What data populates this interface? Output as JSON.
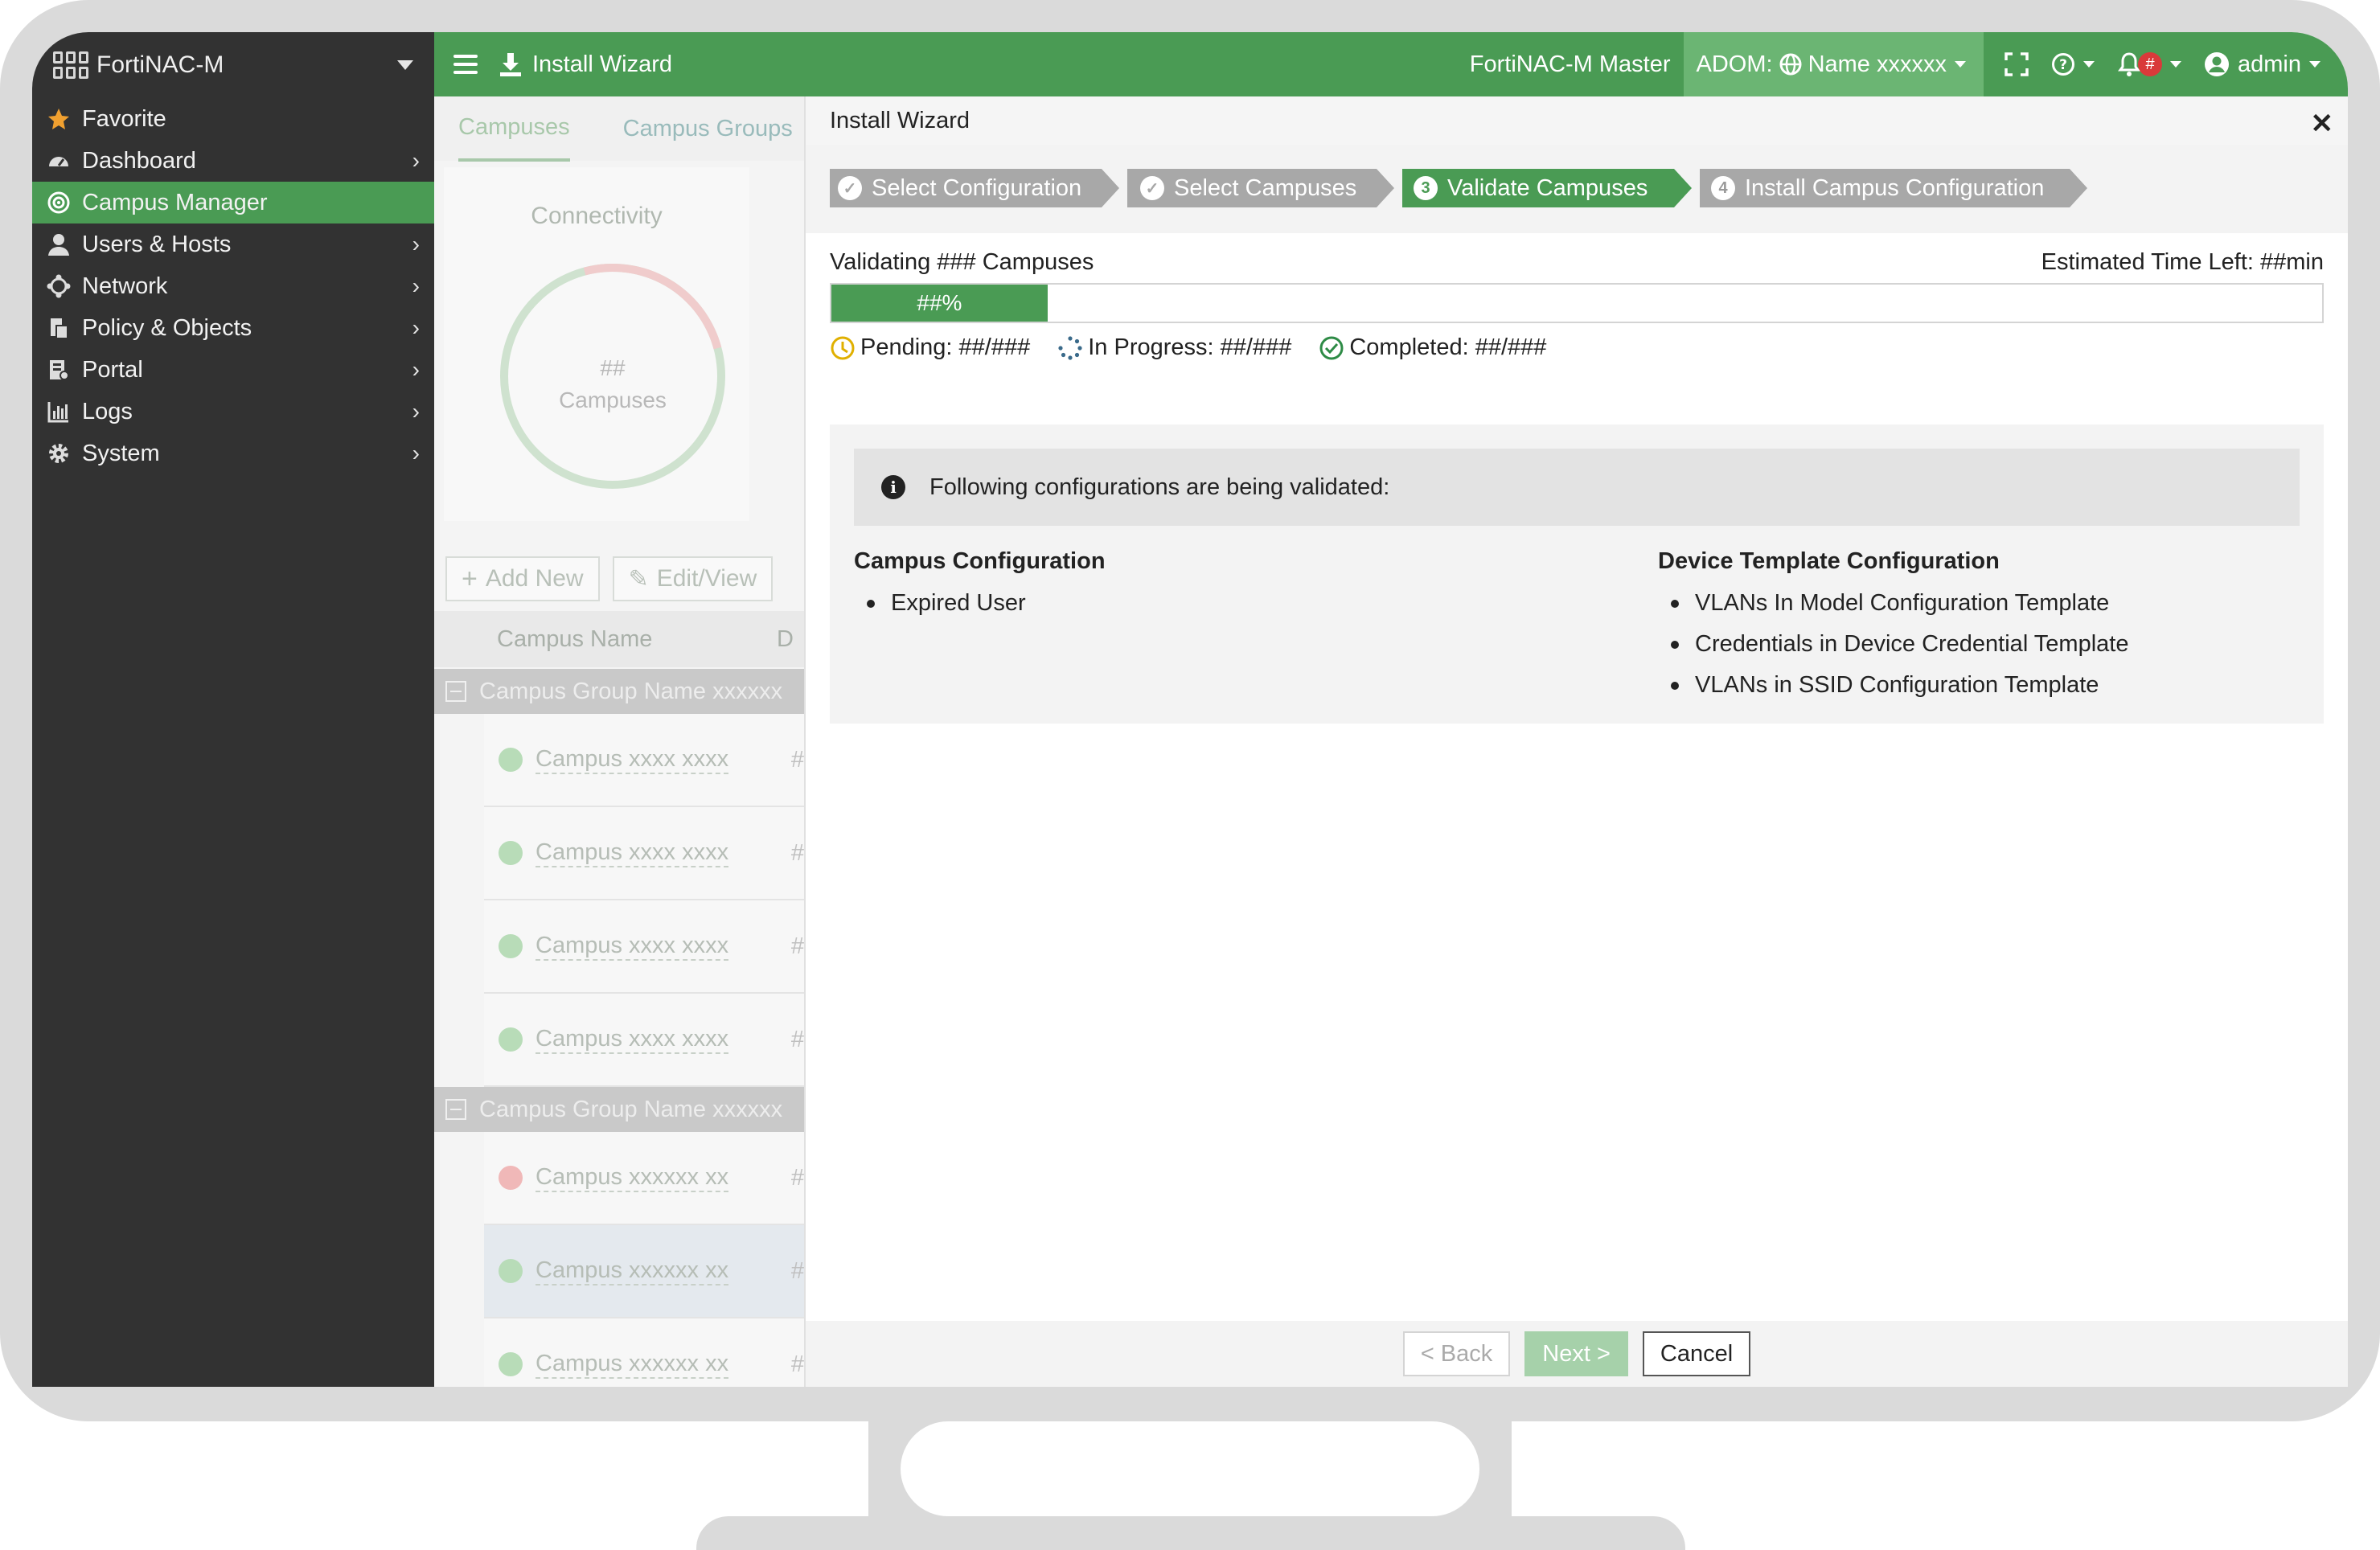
{
  "sidebar": {
    "product": "FortiNAC-M",
    "items": [
      {
        "label": "Favorite",
        "icon": "star-icon",
        "has_children": false,
        "active": false
      },
      {
        "label": "Dashboard",
        "icon": "dashboard-icon",
        "has_children": true,
        "active": false
      },
      {
        "label": "Campus Manager",
        "icon": "campus-icon",
        "has_children": false,
        "active": true
      },
      {
        "label": "Users & Hosts",
        "icon": "user-icon",
        "has_children": true,
        "active": false
      },
      {
        "label": "Network",
        "icon": "network-icon",
        "has_children": true,
        "active": false
      },
      {
        "label": "Policy & Objects",
        "icon": "policy-icon",
        "has_children": true,
        "active": false
      },
      {
        "label": "Portal",
        "icon": "portal-icon",
        "has_children": true,
        "active": false
      },
      {
        "label": "Logs",
        "icon": "logs-icon",
        "has_children": true,
        "active": false
      },
      {
        "label": "System",
        "icon": "gear-icon",
        "has_children": true,
        "active": false
      }
    ]
  },
  "topbar": {
    "page_title": "Install Wizard",
    "master": "FortiNAC-M Master",
    "adom_label": "ADOM:",
    "adom_name": "Name xxxxxx",
    "notification_count": "#",
    "user": "admin"
  },
  "background": {
    "tabs": [
      "Campuses",
      "Campus Groups"
    ],
    "card_title": "Connectivity",
    "donut_value": "##",
    "donut_label": "Campuses",
    "add_button": "Add New",
    "edit_button": "Edit/View",
    "column": "Campus Name",
    "column2": "D",
    "groups": [
      {
        "name": "Campus Group Name xxxxxx",
        "rows": [
          "Campus xxxx xxxx",
          "Campus xxxx xxxx",
          "Campus xxxx xxxx",
          "Campus xxxx xxxx"
        ]
      },
      {
        "name": "Campus Group Name xxxxxx",
        "rows": [
          "Campus xxxxxx xx",
          "Campus xxxxxx xx",
          "Campus xxxxxx xx"
        ]
      }
    ],
    "row_hash": "#"
  },
  "wizard": {
    "title": "Install Wizard",
    "steps": [
      {
        "label": "Select Configuration",
        "state": "done"
      },
      {
        "label": "Select Campuses",
        "state": "done"
      },
      {
        "label": "Validate Campuses",
        "state": "current",
        "number": "3"
      },
      {
        "label": "Install Campus Configuration",
        "state": "todo",
        "number": "4"
      }
    ],
    "validating_text": "Validating ### Campuses",
    "estimated_time": "Estimated Time Left: ##min",
    "progress_label": "##%",
    "progress_fraction": 0.145,
    "pending": "Pending: ##/###",
    "in_progress": "In Progress: ##/###",
    "completed": "Completed: ##/###",
    "notice": "Following configurations are being validated:",
    "campus_config": {
      "title": "Campus Configuration",
      "items": [
        "Expired User"
      ]
    },
    "device_config": {
      "title": "Device Template Configuration",
      "items": [
        "VLANs In Model Configuration Template",
        "Credentials in Device Credential Template",
        "VLANs in SSID Configuration Template"
      ]
    },
    "buttons": {
      "back": "< Back",
      "next": "Next >",
      "cancel": "Cancel"
    }
  },
  "colors": {
    "accent": "#4a9b54",
    "pending": "#e0b000",
    "completed": "#2e8b46",
    "alert": "#d93a3a"
  }
}
